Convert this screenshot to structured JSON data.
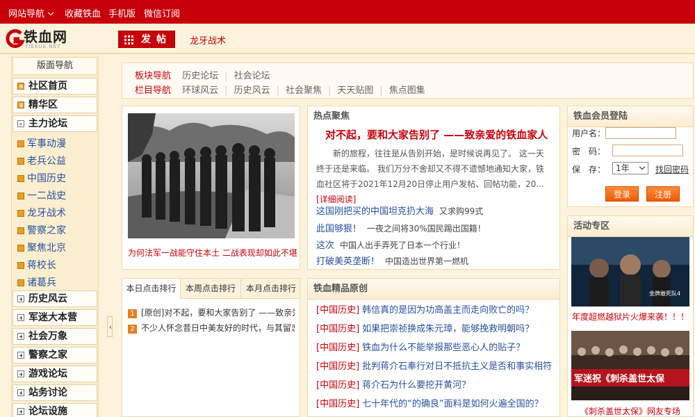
{
  "topbar": {
    "site_nav": "网站导航",
    "bookmark": "收藏铁血",
    "mobile": "手机版",
    "wechat": "微信订阅"
  },
  "header": {
    "logo_text": "铁血网",
    "logo_sub": "TIEXUE.NET",
    "post_button": "发帖",
    "link": "龙牙战术"
  },
  "sidebar": {
    "title": "版面导航",
    "community_home": "社区首页",
    "featured": "精华区",
    "main_forum": "主力论坛",
    "sub_items": [
      "军事动漫",
      "老兵公益",
      "中国历史",
      "一二战史",
      "龙牙战术",
      "警察之家",
      "聚焦北京",
      "蒋校长",
      "诸葛兵"
    ],
    "history": "历史风云",
    "fans_camp": "军迷大本营",
    "society": "社会万象",
    "police": "警察之家",
    "games": "游戏论坛",
    "site_discuss": "站务讨论",
    "facilities": "论坛设施"
  },
  "nav": {
    "board_title": "板块导航",
    "board_items": [
      "历史论坛",
      "社会论坛"
    ],
    "column_title": "栏目导航",
    "column_items": [
      "环球风云",
      "历史风云",
      "社会聚焦",
      "天天贴图",
      "焦点图集"
    ]
  },
  "feature": {
    "caption": "为何法军一战能守住本土 二战表现却如此不堪"
  },
  "ranking": {
    "tabs": [
      "本日点击排行",
      "本周点击排行",
      "本月点击排行"
    ],
    "items": [
      {
        "num": "1",
        "title": "[原创]对不起，要和大家告别了 ——致亲爱的铁血家人"
      },
      {
        "num": "2",
        "title": "不少人怀念昔日中美友好的时代，与其留恋过去"
      }
    ]
  },
  "hot": {
    "title": "热点聚焦",
    "headline": "对不起，要和大家告别了 ——致亲爱的铁血家人",
    "body": "新的旅程，往往是从告别开始，是时候说再见了。 这一天终于还是来临。 我们万分不舍却又不得不遗憾地通知大家，铁血社区将于2021年12月20日停止用户发帖、回帖功能，20...",
    "more": "[详细阅读]",
    "links": [
      {
        "main": "这国刚把买的中国坦克扔大海",
        "sub": "又求购99式"
      },
      {
        "main": "此国够狠！",
        "sub": "一夜之间将30%国民踢出国籍！"
      },
      {
        "main": "这次",
        "sub": "中国人出手弄死了日本一个行业！"
      },
      {
        "main": "打破美英垄断！",
        "sub": "中国造出世界第一燃机"
      }
    ]
  },
  "original": {
    "title": "铁血精品原创",
    "items": [
      {
        "tag": "[中国历史]",
        "title": "韩信真的是因为功高盖主而走向败亡的吗？"
      },
      {
        "tag": "[中国历史]",
        "title": "如果把崇祯换成朱元璋，能够挽救明朝吗？"
      },
      {
        "tag": "[中国历史]",
        "title": "铁血为什么不能举报那些恶心人的贴子？"
      },
      {
        "tag": "[中国历史]",
        "title": "批判蒋介石奉行对日不抵抗主义是否和事实相符？"
      },
      {
        "tag": "[中国历史]",
        "title": "蒋介石为什么要挖开黄河？"
      },
      {
        "tag": "[中国历史]",
        "title": "七十年代的“的确良”面料是如何火遍全国的？"
      }
    ]
  },
  "login": {
    "title": "铁血会员登陆",
    "username_label": "用户名：",
    "password_label": "密　码：",
    "keep_label": "保　存：",
    "keep_value": "1年",
    "recover": "找回密码",
    "login_button": "登录",
    "register_button": "注册"
  },
  "activity": {
    "title": "活动专区",
    "items": [
      {
        "poster_text": "金牌敢死队4",
        "caption": "年度超燃越狱片火爆来袭！！！"
      },
      {
        "poster_text": "军迷祝《刺杀盖世太保",
        "caption": "《刺杀盖世太保》网友专场"
      }
    ]
  },
  "colors": {
    "brand_red": "#c8000a",
    "link_blue": "#2850a0",
    "orange": "#f05b00",
    "background": "#fdf3dc"
  }
}
